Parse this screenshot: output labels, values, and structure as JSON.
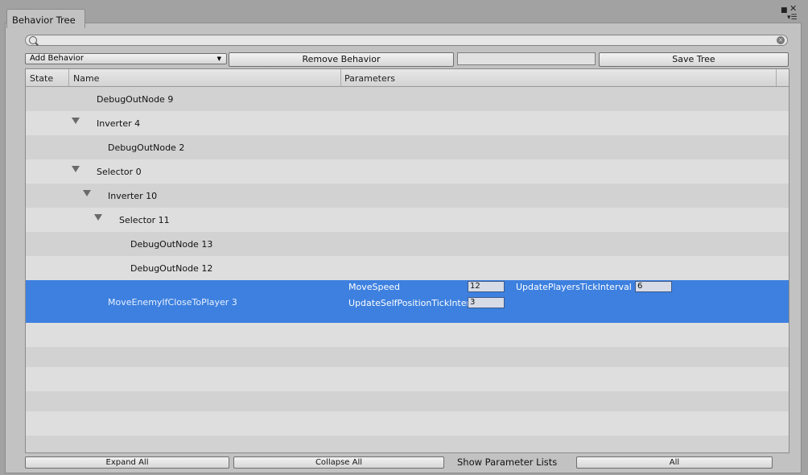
{
  "window": {
    "tab_title": "Behavior Tree",
    "pin_icon": "pin-icon",
    "close_icon": "close-icon",
    "menu_icon": "menu-icon"
  },
  "toolbar": {
    "search_value": "",
    "add_behavior_label": "Add Behavior",
    "remove_behavior_label": "Remove Behavior",
    "name_field_value": "",
    "save_tree_label": "Save Tree"
  },
  "tree": {
    "columns": [
      "State",
      "Name",
      "Parameters"
    ],
    "rows": [
      {
        "label": "DebugOutNode 9",
        "expandable": false,
        "selected": false
      },
      {
        "label": "Inverter 4",
        "expandable": true,
        "selected": false
      },
      {
        "label": "DebugOutNode 2",
        "expandable": false,
        "selected": false
      },
      {
        "label": "Selector 0",
        "expandable": true,
        "selected": false
      },
      {
        "label": "Inverter 10",
        "expandable": true,
        "selected": false
      },
      {
        "label": "Selector 11",
        "expandable": true,
        "selected": false
      },
      {
        "label": "DebugOutNode 13",
        "expandable": false,
        "selected": false
      },
      {
        "label": "DebugOutNode 12",
        "expandable": false,
        "selected": false
      },
      {
        "label": "MoveEnemyIfCloseToPlayer 3",
        "expandable": false,
        "selected": true
      }
    ],
    "selected_params": [
      {
        "name": "MoveSpeed",
        "value": "12"
      },
      {
        "name": "UpdatePlayersTickInterval",
        "value": "6"
      },
      {
        "name": "UpdateSelfPositionTickInterval",
        "value": "3"
      }
    ]
  },
  "footer": {
    "expand_all_label": "Expand All",
    "collapse_all_label": "Collapse All",
    "show_param_lists_label": "Show Parameter Lists",
    "param_list_mode": "All"
  }
}
